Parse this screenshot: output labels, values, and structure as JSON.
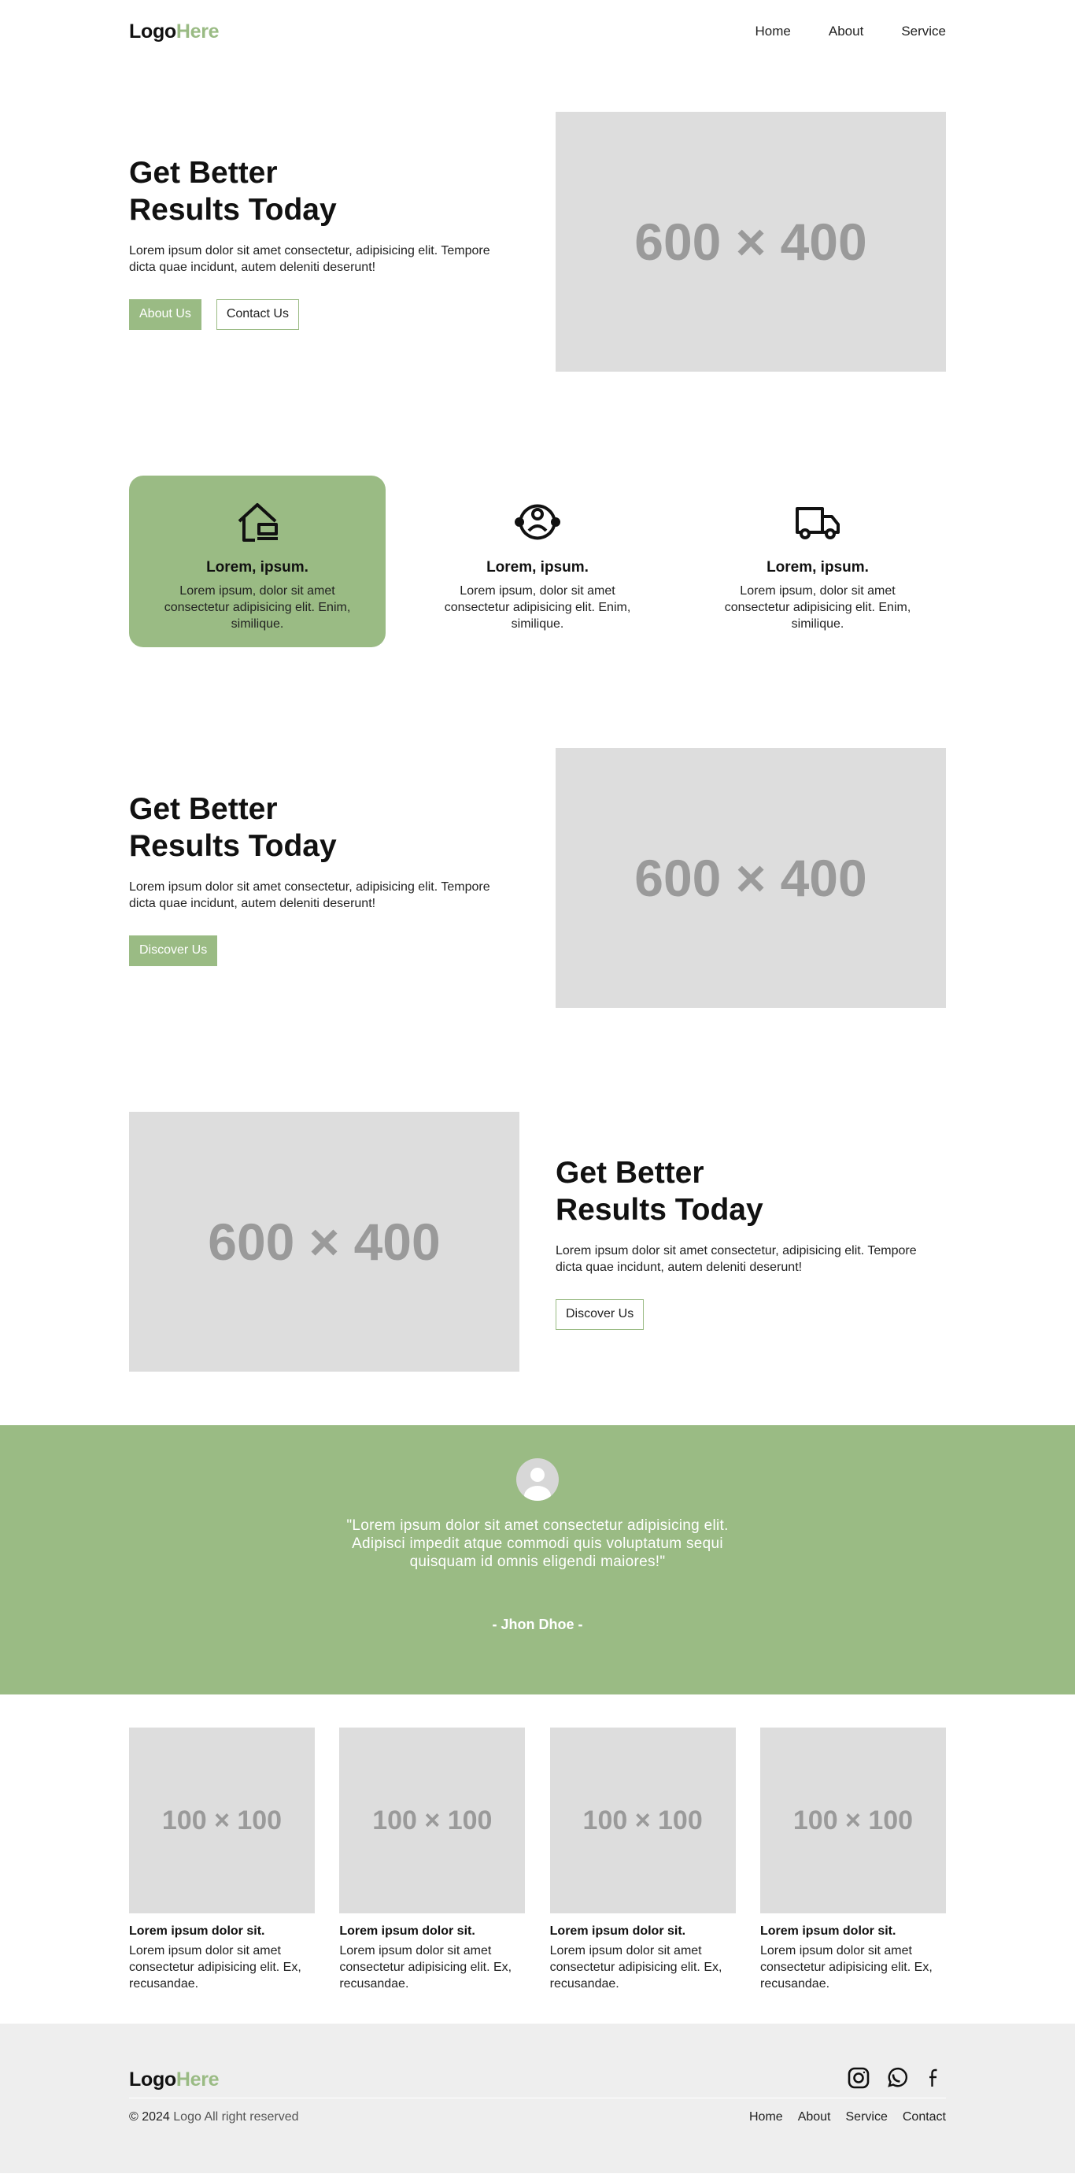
{
  "header": {
    "logo_main": "Logo",
    "logo_accent": "Here",
    "nav": [
      "Home",
      "About",
      "Service"
    ]
  },
  "hero1": {
    "title_line1": "Get Better",
    "title_line2": "Results Today",
    "text": "Lorem ipsum dolor sit amet consectetur, adipisicing elit. Tempore dicta quae incidunt, autem deleniti deserunt!",
    "btn_primary": "About Us",
    "btn_secondary": "Contact Us",
    "image_label": "600 × 400"
  },
  "features": [
    {
      "icon": "house-icon",
      "title": "Lorem, ipsum.",
      "text": "Lorem ipsum, dolor sit amet consectetur adipisicing elit. Enim, similique."
    },
    {
      "icon": "user-support-icon",
      "title": "Lorem, ipsum.",
      "text": "Lorem ipsum, dolor sit amet consectetur adipisicing elit. Enim, similique."
    },
    {
      "icon": "truck-icon",
      "title": "Lorem, ipsum.",
      "text": "Lorem ipsum, dolor sit amet consectetur adipisicing elit. Enim, similique."
    }
  ],
  "hero2": {
    "title_line1": "Get Better",
    "title_line2": "Results Today",
    "text": "Lorem ipsum dolor sit amet consectetur, adipisicing elit. Tempore dicta quae incidunt, autem deleniti deserunt!",
    "btn": "Discover Us",
    "image_label": "600 × 400"
  },
  "hero3": {
    "title_line1": "Get Better",
    "title_line2": "Results Today",
    "text": "Lorem ipsum dolor sit amet consectetur, adipisicing elit. Tempore dicta quae incidunt, autem deleniti deserunt!",
    "btn": "Discover Us",
    "image_label": "600 × 400"
  },
  "testimonial": {
    "quote": "\"Lorem ipsum dolor sit amet consectetur adipisicing elit. Adipisci impedit atque commodi quis voluptatum sequi quisquam id omnis eligendi maiores!\"",
    "author": "- Jhon Dhoe -"
  },
  "cards": [
    {
      "image_label": "100 × 100",
      "title": "Lorem ipsum dolor sit.",
      "text": "Lorem ipsum dolor sit amet consectetur adipisicing elit. Ex, recusandae."
    },
    {
      "image_label": "100 × 100",
      "title": "Lorem ipsum dolor sit.",
      "text": "Lorem ipsum dolor sit amet consectetur adipisicing elit. Ex, recusandae."
    },
    {
      "image_label": "100 × 100",
      "title": "Lorem ipsum dolor sit.",
      "text": "Lorem ipsum dolor sit amet consectetur adipisicing elit. Ex, recusandae."
    },
    {
      "image_label": "100 × 100",
      "title": "Lorem ipsum dolor sit.",
      "text": "Lorem ipsum dolor sit amet consectetur adipisicing elit. Ex, recusandae."
    }
  ],
  "footer": {
    "logo_main": "Logo",
    "logo_accent": "Here",
    "copyright": "© 2024",
    "copyright_rest": "Logo All right reserved",
    "nav": [
      "Home",
      "About",
      "Service",
      "Contact"
    ],
    "socials": [
      "instagram-icon",
      "whatsapp-icon",
      "facebook-icon"
    ]
  },
  "colors": {
    "accent": "#9abb84",
    "placeholder": "#dddddd",
    "footer_bg": "#eeeeee"
  }
}
